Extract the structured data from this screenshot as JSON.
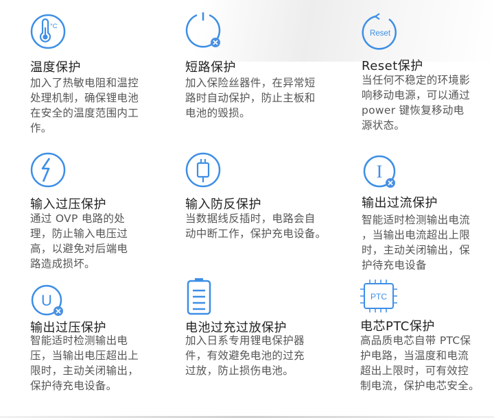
{
  "colors": {
    "accent": "#3c8ee6",
    "badge": "#4a90e2",
    "title": "#222222",
    "text": "#555555"
  },
  "features": [
    {
      "id": "temperature",
      "icon": "thermometer-icon",
      "icon_text": "°C",
      "title": "温度保护",
      "desc_lines": [
        "加入了热敏电阻和温控",
        "处理机制，确保锂电池",
        "在安全的温度范围内工",
        "作。"
      ]
    },
    {
      "id": "short-circuit",
      "icon": "power-icon",
      "title": "短路保护",
      "desc_lines": [
        "加入保险丝器件，在异常短",
        "路时自动保护，防止主板和",
        "电池的毁损。"
      ]
    },
    {
      "id": "reset",
      "icon": "reset-icon",
      "icon_text": "Reset",
      "title": "Reset保护",
      "desc_lines": [
        "当任何不稳定的环境影",
        "响移动电源，可以通过",
        "power 键恢复移动电",
        "源状态。"
      ]
    },
    {
      "id": "input-overvoltage",
      "icon": "lightning-icon",
      "title": "输入过压保护",
      "desc_lines": [
        "通过 OVP 电路的处",
        "理，防止输入电压过",
        "高，以避免对后端电",
        "路造成损坏。"
      ]
    },
    {
      "id": "input-reverse",
      "icon": "usb-plug-icon",
      "title": "输入防反保护",
      "desc_lines": [
        "当数据线反插时，电路会自",
        "动中断工作，保护充电设备。"
      ]
    },
    {
      "id": "output-overcurrent",
      "icon": "current-icon",
      "icon_text": "I",
      "title": "输出过流保护",
      "desc_lines": [
        "智能适时检测输出电流",
        "，当输出电流超出上限",
        "时，主动关闭输出，保",
        "护待充电设备"
      ]
    },
    {
      "id": "output-overvoltage",
      "icon": "voltage-icon",
      "icon_text": "U",
      "title": "输出过压保护",
      "desc_lines": [
        "智能适时检测输出电",
        "压，当输出电压超出上",
        "限时，主动关闭输出，",
        "保护待充电设备。"
      ]
    },
    {
      "id": "battery-overcharge",
      "icon": "battery-icon",
      "title": "电池过充过放保护",
      "desc_lines": [
        "加入日系专用锂电保护器",
        "件，有效避免电池的过充",
        "过放，防止损伤电池。"
      ]
    },
    {
      "id": "cell-ptc",
      "icon": "chip-icon",
      "icon_text": "PTC",
      "title": "电芯PTC保护",
      "desc_lines": [
        "高品质电芯自带 PTC保",
        "护电路，当温度和电流",
        "超出上限时，可有效控",
        "制电流，保护电芯安全。"
      ]
    }
  ]
}
